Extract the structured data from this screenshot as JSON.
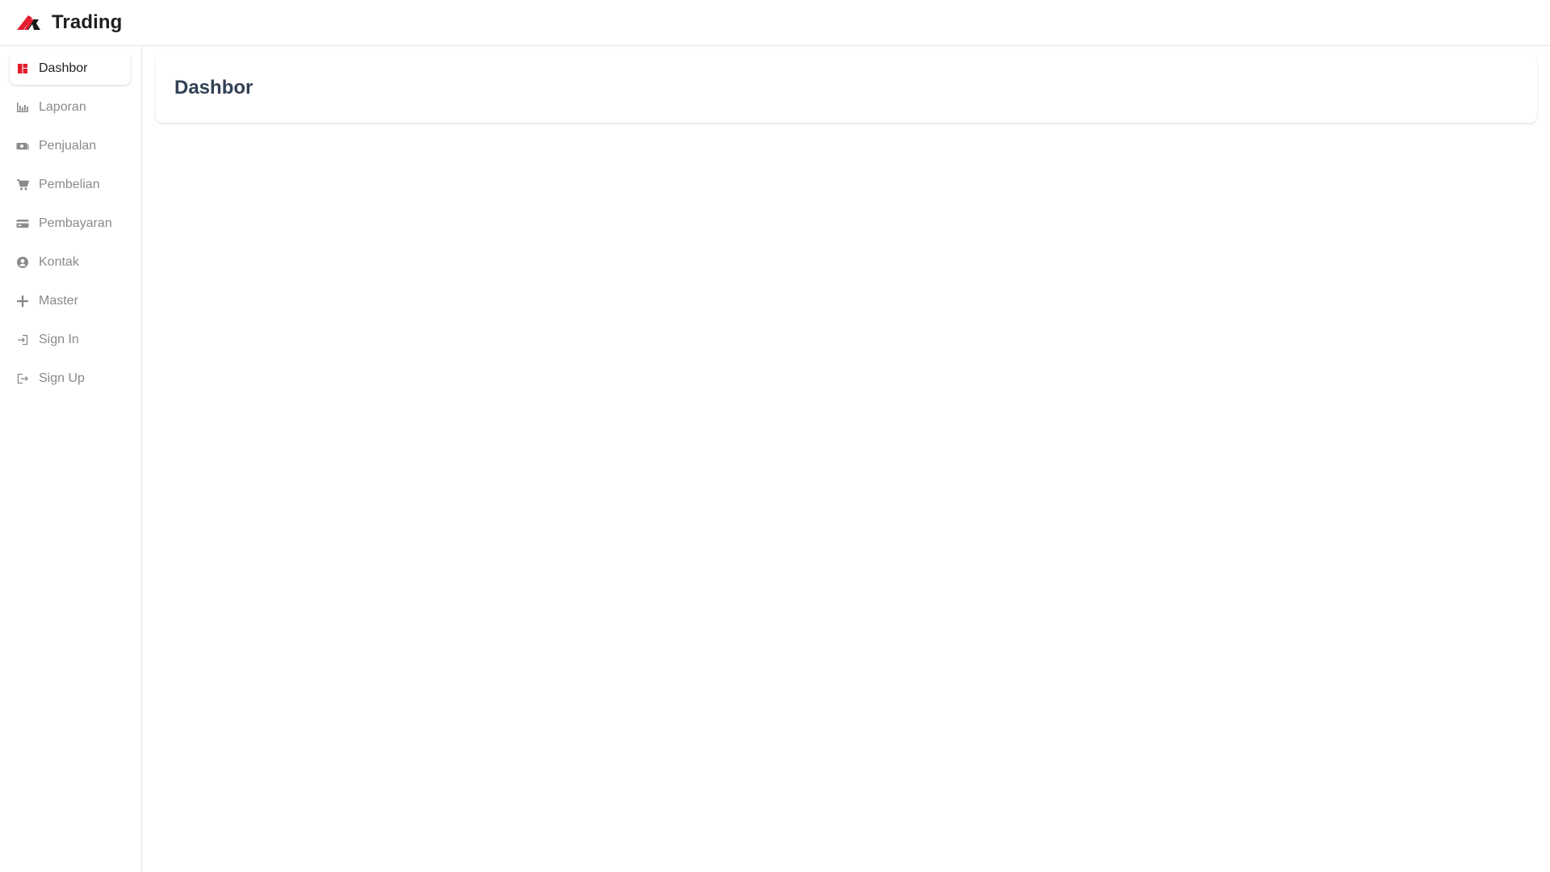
{
  "app": {
    "name": "Trading",
    "accent_color": "#e11d2e"
  },
  "sidebar": {
    "items": [
      {
        "label": "Dashbor",
        "icon": "dashboard-icon",
        "active": true
      },
      {
        "label": "Laporan",
        "icon": "bar-chart-icon",
        "active": false
      },
      {
        "label": "Penjualan",
        "icon": "money-icon",
        "active": false
      },
      {
        "label": "Pembelian",
        "icon": "cart-icon",
        "active": false
      },
      {
        "label": "Pembayaran",
        "icon": "credit-card-icon",
        "active": false
      },
      {
        "label": "Kontak",
        "icon": "user-circle-icon",
        "active": false
      },
      {
        "label": "Master",
        "icon": "plus-icon",
        "active": false
      },
      {
        "label": "Sign In",
        "icon": "sign-in-icon",
        "active": false
      },
      {
        "label": "Sign Up",
        "icon": "sign-up-icon",
        "active": false
      }
    ]
  },
  "main": {
    "title": "Dashbor"
  }
}
